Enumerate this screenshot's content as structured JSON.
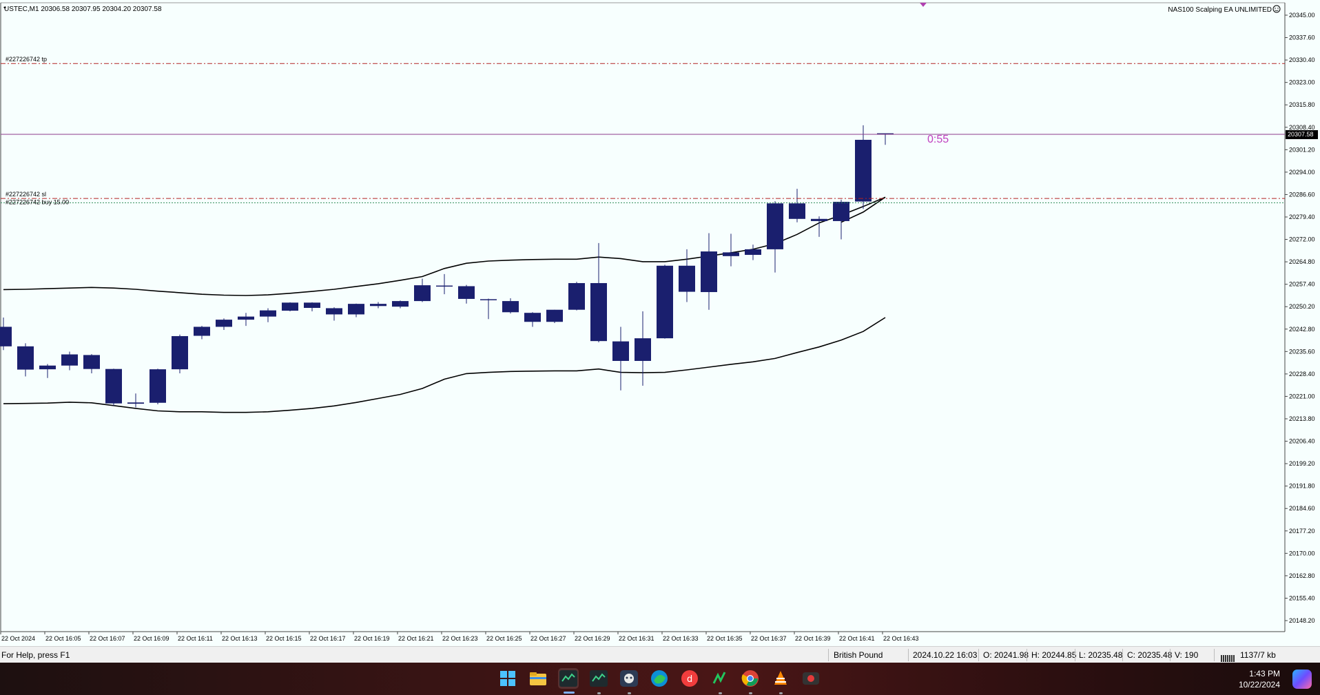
{
  "chart": {
    "symbol_header": "USTEC,M1  20306.58 20307.95 20304.20 20307.58",
    "ea_label": "NAS100 Scalping EA UNLIMITED",
    "ea_icon": "smiley-icon",
    "countdown": "0:55",
    "current_price_label": "20307.58",
    "order_tp_label": "#227226742 tp",
    "order_sl_label": "#227226742 sl",
    "order_buy_label": "#227226742 buy 15.00",
    "colors": {
      "background": "#f7fffe",
      "candle": "#1a1f6e",
      "bands": "#000000",
      "tp_sl_line": "#b22222",
      "entry_line": "#2e8b57",
      "price_line": "#8b3a8b",
      "countdown": "#c040c0"
    }
  },
  "chart_data": {
    "type": "candlestick",
    "price_axis_ticks": [
      "20345.00",
      "20337.60",
      "20330.40",
      "20323.00",
      "20315.80",
      "20308.40",
      "20301.20",
      "20294.00",
      "20286.60",
      "20279.40",
      "20272.00",
      "20264.80",
      "20257.40",
      "20250.20",
      "20242.80",
      "20235.60",
      "20228.40",
      "20221.00",
      "20213.80",
      "20206.40",
      "20199.20",
      "20191.80",
      "20184.60",
      "20177.20",
      "20170.00",
      "20162.80",
      "20155.40",
      "20148.20"
    ],
    "time_axis_ticks": [
      "22 Oct 2024",
      "22 Oct 16:05",
      "22 Oct 16:07",
      "22 Oct 16:09",
      "22 Oct 16:11",
      "22 Oct 16:13",
      "22 Oct 16:15",
      "22 Oct 16:17",
      "22 Oct 16:19",
      "22 Oct 16:21",
      "22 Oct 16:23",
      "22 Oct 16:25",
      "22 Oct 16:27",
      "22 Oct 16:29",
      "22 Oct 16:31",
      "22 Oct 16:33",
      "22 Oct 16:35",
      "22 Oct 16:37",
      "22 Oct 16:39",
      "22 Oct 16:41",
      "22 Oct 16:43"
    ],
    "ylim": [
      20147.2,
      20350.0
    ],
    "bar_count": 41,
    "candles": [
      [
        20245.5,
        20248.5,
        20238.0,
        20239.2
      ],
      [
        20239.2,
        20240.2,
        20229.5,
        20231.7
      ],
      [
        20231.8,
        20233.5,
        20229.0,
        20233.0
      ],
      [
        20233.0,
        20237.5,
        20231.5,
        20236.6
      ],
      [
        20236.4,
        20236.7,
        20230.5,
        20231.9
      ],
      [
        20231.9,
        20232.0,
        20220.0,
        20220.8
      ],
      [
        20220.7,
        20224.0,
        20219.5,
        20221.1
      ],
      [
        20221.0,
        20232.0,
        20220.5,
        20231.8
      ],
      [
        20231.8,
        20243.0,
        20230.5,
        20242.5
      ],
      [
        20242.6,
        20245.8,
        20241.5,
        20245.5
      ],
      [
        20245.5,
        20248.2,
        20244.5,
        20247.8
      ],
      [
        20247.8,
        20250.0,
        20245.8,
        20248.8
      ],
      [
        20248.8,
        20251.5,
        20247.0,
        20250.8
      ],
      [
        20250.7,
        20253.4,
        20250.5,
        20253.3
      ],
      [
        20253.3,
        20253.4,
        20250.5,
        20251.6
      ],
      [
        20251.5,
        20251.8,
        20247.5,
        20249.5
      ],
      [
        20249.5,
        20253.0,
        20248.6,
        20252.9
      ],
      [
        20252.9,
        20253.5,
        20251.5,
        20252.2
      ],
      [
        20252.0,
        20254.0,
        20251.5,
        20253.8
      ],
      [
        20253.8,
        20261.0,
        20253.5,
        20258.9
      ],
      [
        20258.8,
        20262.5,
        20256.0,
        20258.8
      ],
      [
        20258.6,
        20259.0,
        20253.0,
        20254.5
      ],
      [
        20254.4,
        20254.6,
        20248.0,
        20254.4
      ],
      [
        20253.8,
        20254.7,
        20249.8,
        20250.2
      ],
      [
        20250.0,
        20250.2,
        20245.5,
        20247.1
      ],
      [
        20247.1,
        20251.0,
        20246.7,
        20251.0
      ],
      [
        20251.0,
        20260.0,
        20250.8,
        20259.6
      ],
      [
        20259.6,
        20272.5,
        20240.5,
        20240.9
      ],
      [
        20240.8,
        20245.5,
        20225.0,
        20234.5
      ],
      [
        20234.5,
        20250.5,
        20226.5,
        20241.8
      ],
      [
        20241.8,
        20265.5,
        20241.7,
        20265.2
      ],
      [
        20265.2,
        20270.5,
        20253.5,
        20256.8
      ],
      [
        20256.7,
        20275.7,
        20251.0,
        20269.8
      ],
      [
        20269.5,
        20275.5,
        20265.0,
        20268.3
      ],
      [
        20268.7,
        20272.0,
        20267.0,
        20270.5
      ],
      [
        20270.5,
        20286.0,
        20263.0,
        20285.3
      ],
      [
        20285.3,
        20290.0,
        20279.2,
        20280.3
      ],
      [
        20280.3,
        20281.1,
        20274.5,
        20279.6
      ],
      [
        20279.6,
        20286.5,
        20273.7,
        20285.8
      ],
      [
        20285.9,
        20310.5,
        20283.5,
        20305.8
      ],
      [
        20307.9,
        20307.9,
        20304.2,
        20307.58
      ]
    ],
    "bands": {
      "upper": [
        20257.5,
        20257.6,
        20257.8,
        20258.0,
        20258.2,
        20258.0,
        20257.6,
        20257.0,
        20256.5,
        20256.0,
        20255.7,
        20255.6,
        20255.8,
        20256.3,
        20256.9,
        20257.6,
        20258.5,
        20259.4,
        20260.5,
        20261.7,
        20264.3,
        20266.0,
        20266.7,
        20267.0,
        20267.2,
        20267.3,
        20267.3,
        20268.0,
        20267.5,
        20266.5,
        20266.5,
        20267.3,
        20268.3,
        20269.4,
        20270.5,
        20272.3,
        20275.3,
        20279.0,
        20281.5,
        20284.3,
        20287.3
      ],
      "middle": [
        null,
        null,
        null,
        null,
        null,
        null,
        null,
        null,
        null,
        null,
        null,
        null,
        null,
        null,
        null,
        null,
        null,
        null,
        null,
        null,
        null,
        null,
        null,
        null,
        null,
        null,
        null,
        null,
        null,
        null,
        null,
        null,
        null,
        null,
        null,
        null,
        null,
        null,
        20279.2,
        20282.5,
        20287.3
      ],
      "lower": [
        20220.7,
        20220.8,
        20220.9,
        20221.2,
        20221.0,
        20220.1,
        20219.2,
        20218.4,
        20218.1,
        20218.1,
        20217.9,
        20217.9,
        20218.1,
        20218.6,
        20219.2,
        20220.0,
        20221.1,
        20222.4,
        20223.7,
        20225.6,
        20228.6,
        20230.4,
        20230.8,
        20231.1,
        20231.2,
        20231.3,
        20231.3,
        20231.9,
        20230.8,
        20230.7,
        20230.8,
        20231.6,
        20232.5,
        20233.4,
        20234.2,
        20235.3,
        20237.2,
        20239.0,
        20241.2,
        20244.0,
        20248.5
      ]
    },
    "levels": {
      "tp": 20330.4,
      "sl": 20286.9,
      "entry": 20285.5,
      "bid": 20307.58
    },
    "grid": false
  },
  "status": {
    "help": "For Help, press F1",
    "profile": "British Pound",
    "datetime": "2024.10.22 16:03",
    "open": "O: 20241.98",
    "high": "H: 20244.85",
    "low": "L: 20235.48",
    "close": "C: 20235.48",
    "volume": "V: 190",
    "traffic": "1137/7 kb",
    "traffic_icon": "connection-bars-icon"
  },
  "taskbar": {
    "time": "1:43 PM",
    "date": "10/22/2024",
    "apps": [
      "windows-start-icon",
      "file-explorer-icon",
      "metatrader-icon",
      "metatrader-icon",
      "app-icon",
      "edge-icon",
      "app-icon",
      "app-icon",
      "chrome-icon",
      "vlc-icon",
      "recorder-icon"
    ]
  }
}
